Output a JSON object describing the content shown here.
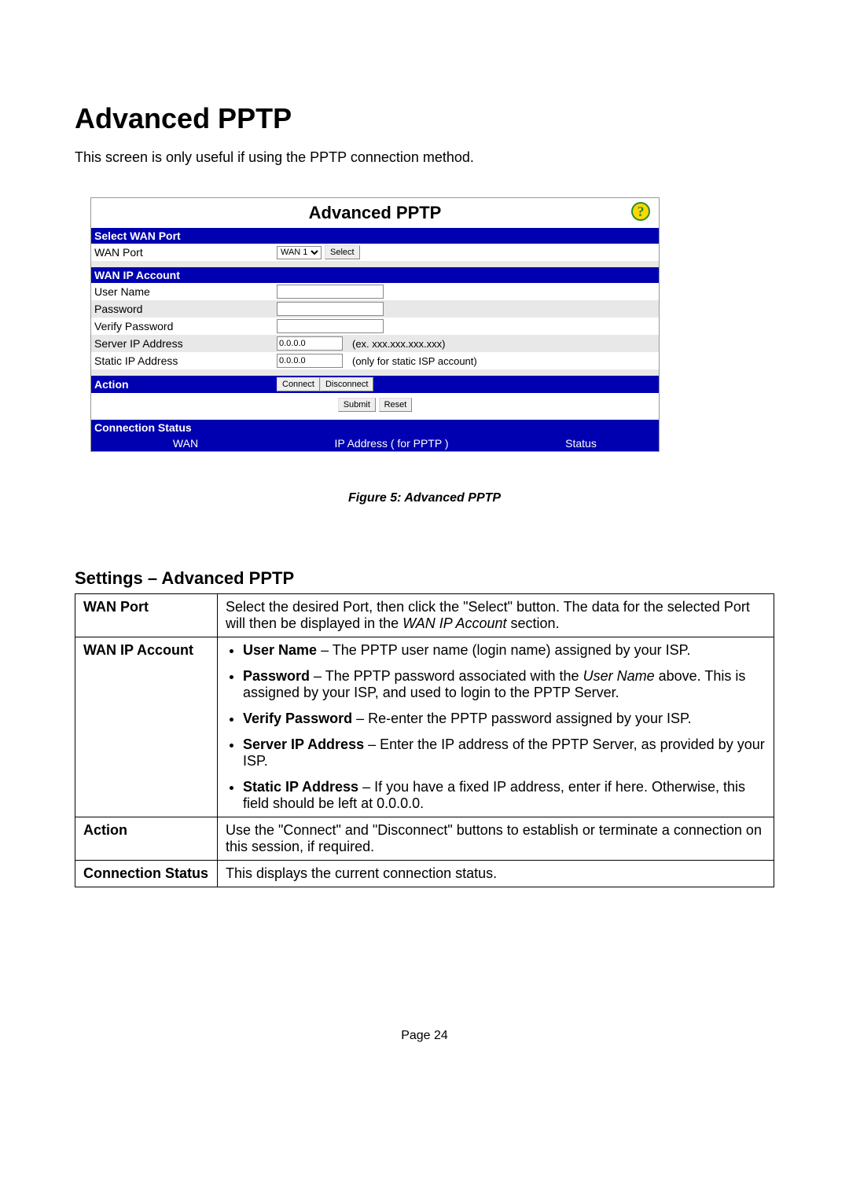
{
  "heading": "Advanced PPTP",
  "intro": "This screen is only useful if using the PPTP connection method.",
  "panel": {
    "title": "Advanced PPTP",
    "sections": {
      "select_wan_port": "Select WAN Port",
      "wan_ip_account": "WAN IP Account",
      "action": "Action",
      "connection_status": "Connection Status"
    },
    "labels": {
      "wan_port": "WAN Port",
      "user_name": "User Name",
      "password": "Password",
      "verify_password": "Verify Password",
      "server_ip": "Server IP Address",
      "static_ip": "Static IP Address"
    },
    "values": {
      "wan_select": "WAN 1",
      "server_ip": "0.0.0.0",
      "static_ip": "0.0.0.0"
    },
    "hints": {
      "server_ip": "(ex. xxx.xxx.xxx.xxx)",
      "static_ip": "(only for static ISP account)"
    },
    "buttons": {
      "select": "Select",
      "connect": "Connect",
      "disconnect": "Disconnect",
      "submit": "Submit",
      "reset": "Reset"
    },
    "status_cols": {
      "wan": "WAN",
      "ip": "IP Address ( for PPTP )",
      "status": "Status"
    }
  },
  "figure_caption": "Figure 5:  Advanced PPTP",
  "settings_title": "Settings – Advanced PPTP",
  "settings_table": {
    "wan_port": {
      "label": "WAN Port",
      "text_a": "Select the desired Port, then click the \"Select\" button. The data for the selected Port will then be displayed in the ",
      "text_i": "WAN IP Account",
      "text_b": " section."
    },
    "wan_ip_account": {
      "label": "WAN IP Account",
      "items": {
        "user_name_b": "User Name",
        "user_name_t": " – The PPTP user name (login name) assigned by your ISP.",
        "password_b": "Password",
        "password_t1": " – The PPTP password associated with the ",
        "password_i": "User Name",
        "password_t2": " above. This is assigned by your ISP, and used to login to the PPTP Server.",
        "verify_b": "Verify Password",
        "verify_t": " – Re-enter the PPTP password assigned by your ISP.",
        "server_b": "Server IP Address",
        "server_t": " – Enter the IP address of the PPTP Server, as provided by your ISP.",
        "static_b": "Static IP Address",
        "static_t": " – If you have a fixed IP address, enter if here. Otherwise, this field should be left at 0.0.0.0."
      }
    },
    "action": {
      "label": "Action",
      "text": "Use the \"Connect\" and \"Disconnect\" buttons to establish or terminate a connection on this session, if required."
    },
    "connection_status": {
      "label": "Connection Status",
      "text": "This displays the current connection status."
    }
  },
  "page_number": "Page 24"
}
